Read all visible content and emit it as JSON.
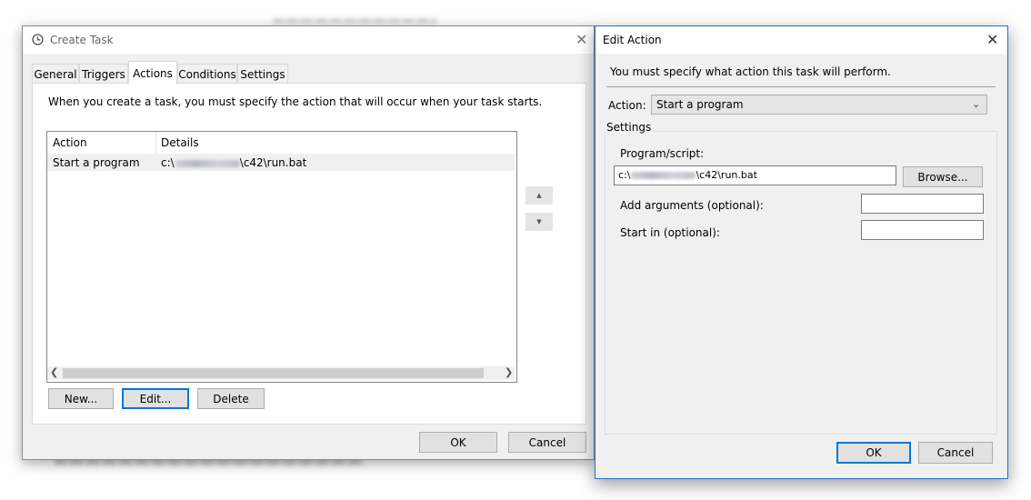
{
  "create_task": {
    "title": "Create Task",
    "tabs": [
      {
        "label": "General"
      },
      {
        "label": "Triggers"
      },
      {
        "label": "Actions"
      },
      {
        "label": "Conditions"
      },
      {
        "label": "Settings"
      }
    ],
    "description": "When you create a task, you must specify the action that will occur when your task starts.",
    "table": {
      "columns": [
        "Action",
        "Details"
      ],
      "rows": [
        {
          "action": "Start a program",
          "details_prefix": "c:\\",
          "details_suffix": "\\c42\\run.bat"
        }
      ]
    },
    "buttons": {
      "new": "New...",
      "edit": "Edit...",
      "delete": "Delete",
      "ok": "OK",
      "cancel": "Cancel"
    }
  },
  "edit_action": {
    "title": "Edit Action",
    "instruction": "You must specify what action this task will perform.",
    "action_label": "Action:",
    "action_value": "Start a program",
    "settings_label": "Settings",
    "program_label": "Program/script:",
    "program_prefix": "c:\\",
    "program_suffix": "\\c42\\run.bat",
    "browse": "Browse...",
    "arguments_label": "Add arguments (optional):",
    "start_in_label": "Start in (optional):",
    "ok": "OK",
    "cancel": "Cancel"
  },
  "colors": {
    "accent": "#0078d7",
    "selected_row": "#f0f0f0",
    "window_bg": "#f0f0f0"
  },
  "icons": [
    "clock-icon",
    "close-icon",
    "up-arrow-icon",
    "down-arrow-icon",
    "scroll-left-icon",
    "scroll-right-icon",
    "chevron-down-icon"
  ]
}
